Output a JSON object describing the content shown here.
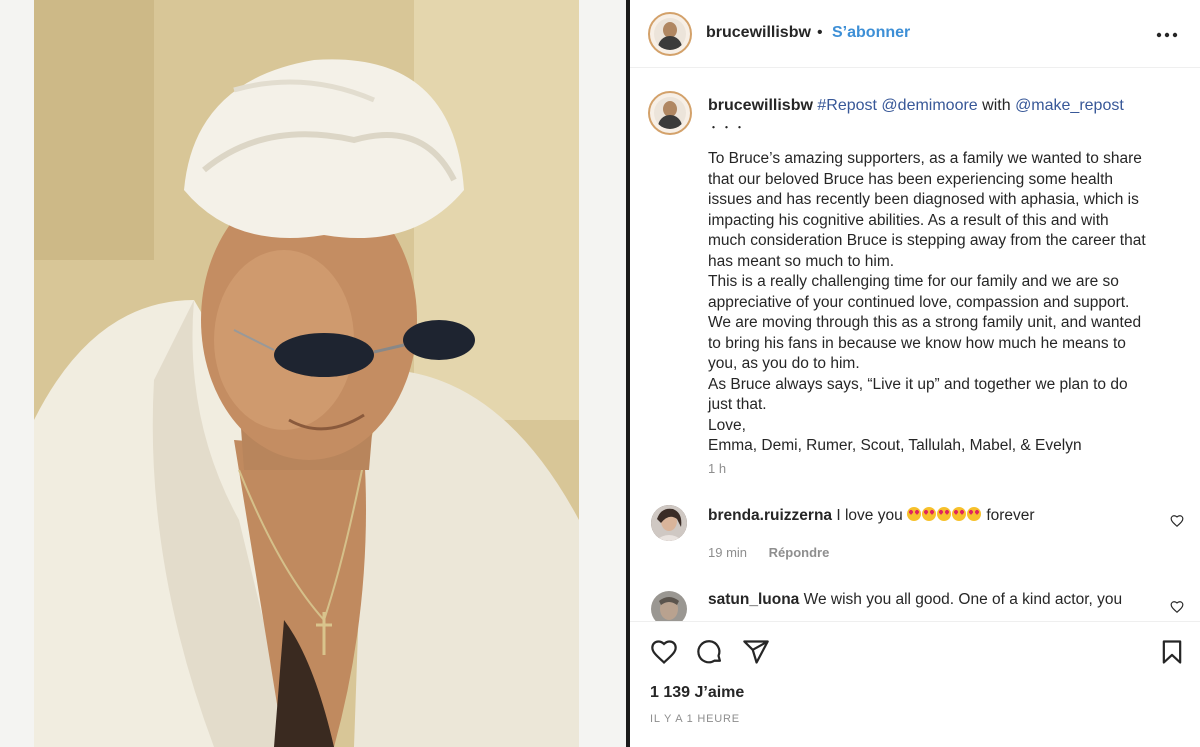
{
  "header": {
    "username": "brucewillisbw",
    "separator": "•",
    "follow_label": "S’abonner",
    "more_icon": "more-horizontal-icon"
  },
  "caption": {
    "username": "brucewillisbw",
    "hashtag": "#Repost",
    "mention1": "@demimoore",
    "with_word": "with",
    "mention2": "@make_repost",
    "dots": "・・・",
    "lines": [
      "To Bruce’s amazing supporters, as a family we wanted to share",
      "that our beloved Bruce has been experiencing some health",
      "issues and has recently been diagnosed with aphasia, which is",
      "impacting his cognitive abilities. As a result of this and with",
      "much consideration Bruce is stepping away from the career that",
      "has meant so much to him.",
      "This is a really challenging time for our family and we are so",
      "appreciative of your continued love, compassion and support.",
      "We are moving through this as a strong family unit, and wanted",
      "to bring his fans in because we know how much he means to",
      "you, as you do to him.",
      "As Bruce always says, “Live it up” and together we plan to do",
      "just that.",
      "Love,",
      "Emma, Demi, Rumer, Scout, Tallulah, Mabel, & Evelyn"
    ],
    "time": "1 h"
  },
  "comments": [
    {
      "username": "brenda.ruizzerna",
      "text_before": "I love you",
      "emoji_name": "heart-eyes-emoji",
      "emoji_count": 5,
      "text_after": "forever",
      "time": "19 min",
      "reply_label": "Répondre"
    },
    {
      "username": "satun_luona",
      "text": "We wish you all good. One of a kind actor, you"
    }
  ],
  "actions": {
    "like_icon": "heart-icon",
    "comment_icon": "comment-icon",
    "share_icon": "paper-plane-icon",
    "save_icon": "bookmark-icon",
    "likes": "1 139 J’aime",
    "post_time": "IL Y A 1 HEURE"
  },
  "colors": {
    "link_blue": "#3d8fd6",
    "mention_blue": "#385898",
    "text": "#262626",
    "secondary": "#8e8e8e"
  }
}
